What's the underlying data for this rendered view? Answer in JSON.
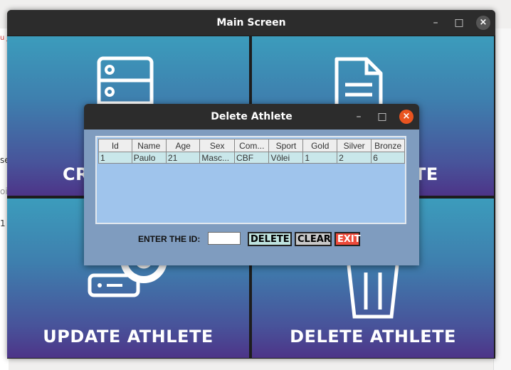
{
  "background_app": {
    "fragments": [
      "u J",
      "se",
      "oi",
      "1"
    ]
  },
  "main_window": {
    "title": "Main Screen",
    "controls": {
      "minimize": "–",
      "maximize": "□",
      "close": "×"
    },
    "tiles": [
      {
        "label": "CREATE ATHLETE",
        "icon": "database-icon"
      },
      {
        "label": "READ ATHLETE",
        "icon": "document-icon"
      },
      {
        "label": "UPDATE ATHLETE",
        "icon": "server-gear-icon"
      },
      {
        "label": "DELETE ATHLETE",
        "icon": "trash-icon"
      }
    ],
    "visible_labels": {
      "top_left": "CR",
      "top_right": "TE",
      "bottom_left": "UPDATE ATHLETE",
      "bottom_right": "DELETE ATHLETE"
    }
  },
  "dialog": {
    "title": "Delete Athlete",
    "controls": {
      "minimize": "–",
      "maximize": "□",
      "close": "×"
    },
    "table": {
      "columns": [
        "Id",
        "Name",
        "Age",
        "Sex",
        "Com...",
        "Sport",
        "Gold",
        "Silver",
        "Bronze"
      ],
      "rows": [
        [
          "1",
          "Paulo",
          "21",
          "Masc...",
          "CBF",
          "Vôlei",
          "1",
          "2",
          "6"
        ]
      ]
    },
    "id_label": "ENTER THE ID:",
    "id_value": "",
    "buttons": {
      "delete": "DELETE",
      "clear": "CLEAR",
      "exit": "EXIT"
    }
  },
  "colors": {
    "tile_gradient_top": "#3c9cbc",
    "tile_gradient_bottom": "#4d3488",
    "dialog_bg": "#7f9cbf",
    "table_bg": "#9fc4ec",
    "row_bg": "#c9e7ea",
    "delete_btn": "#bfe3df",
    "clear_btn": "#c9c9c9",
    "exit_btn": "#ee4a3a",
    "close_btn": "#e95420"
  }
}
